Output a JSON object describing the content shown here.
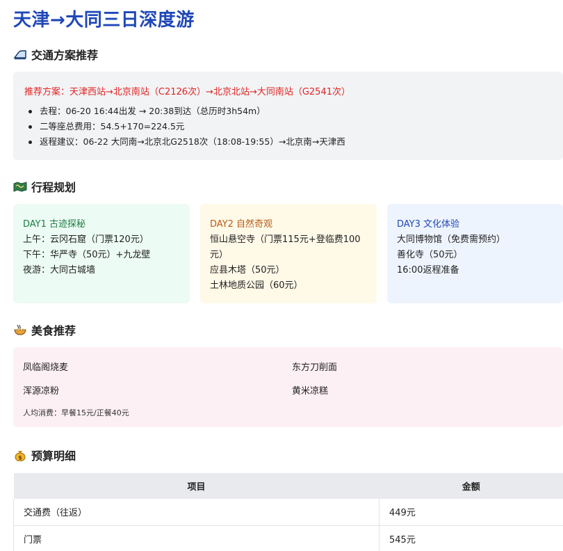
{
  "page_title": "天津→大同三日深度游",
  "transport": {
    "heading": "交通方案推荐",
    "icon": "train-icon",
    "recommendation": "推荐方案：天津西站→北京南站（C2126次）→北京北站→大同南站（G2541次）",
    "bullets": [
      "去程：06-20 16:44出发 → 20:38到达（总历时3h54m）",
      "二等座总费用：54.5+170=224.5元",
      "返程建议：06-22 大同南→北京北G2518次（18:08-19:55）→北京南→天津西"
    ]
  },
  "itinerary": {
    "heading": "行程规划",
    "icon": "map-icon",
    "days": [
      {
        "title": "DAY1 古迹探秘",
        "lines": [
          "上午：云冈石窟（门票120元）",
          "下午：华严寺（50元）+九龙壁",
          "夜游：大同古城墙"
        ]
      },
      {
        "title": "DAY2 自然奇观",
        "lines": [
          "恒山悬空寺（门票115元+登临费100元）",
          "应县木塔（50元）",
          "土林地质公园（60元）"
        ]
      },
      {
        "title": "DAY3 文化体验",
        "lines": [
          "大同博物馆（免费需预约）",
          "善化寺（50元）",
          "16:00返程准备"
        ]
      }
    ]
  },
  "food": {
    "heading": "美食推荐",
    "icon": "noodle-bowl-icon",
    "items": [
      "凤临阁烧麦",
      "东方刀削面",
      "浑源凉粉",
      "黄米凉糕"
    ],
    "note": "人均消费：早餐15元/正餐40元"
  },
  "budget": {
    "heading": "预算明细",
    "icon": "money-bag-icon",
    "columns": [
      "项目",
      "金额"
    ],
    "rows": [
      [
        "交通费（往返）",
        "449元"
      ],
      [
        "门票",
        "545元"
      ]
    ]
  }
}
